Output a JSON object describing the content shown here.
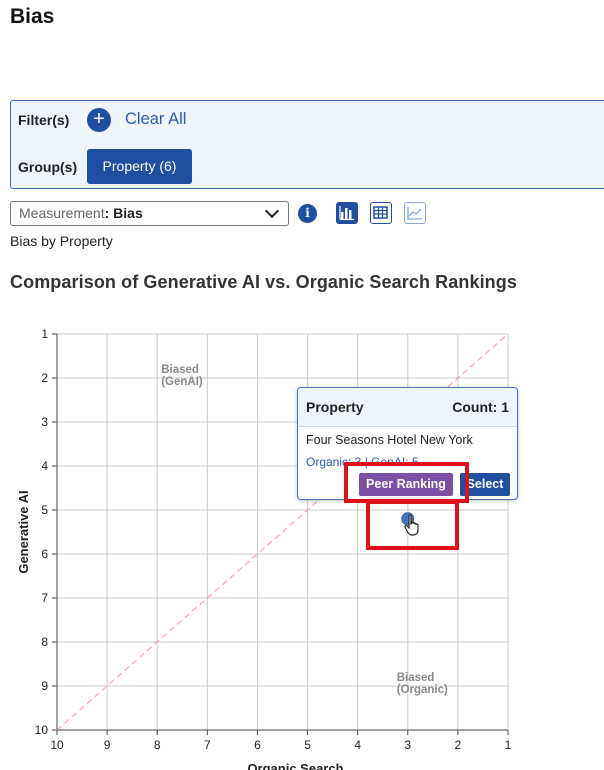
{
  "page": {
    "title": "Bias"
  },
  "filters": {
    "filter_label": "Filter(s)",
    "add_icon": "plus-circle-icon",
    "clear_all": "Clear All",
    "group_label": "Group(s)",
    "group_chip": "Property (6)"
  },
  "measurement": {
    "prefix": "Measurement",
    "separator": ": ",
    "value": "Bias",
    "dropdown_icon": "chevron-down-icon"
  },
  "toolbar": {
    "info_icon": "info-icon",
    "info_glyph": "i",
    "views": [
      {
        "icon": "bar-chart-icon",
        "active": true
      },
      {
        "icon": "table-icon",
        "active": false
      },
      {
        "icon": "line-chart-icon",
        "active": false
      }
    ]
  },
  "subtitle": "Bias by Property",
  "chart_title": "Comparison of Generative AI vs. Organic Search Rankings",
  "chart_data": {
    "type": "scatter",
    "xlabel": "Organic Search",
    "ylabel": "Generative AI",
    "xlim": [
      10,
      1
    ],
    "ylim": [
      1,
      10
    ],
    "x_reversed": true,
    "y_reversed": true,
    "x_ticks": [
      "10",
      "9",
      "8",
      "7",
      "6",
      "5",
      "4",
      "3",
      "2",
      "1"
    ],
    "y_ticks": [
      "1",
      "2",
      "3",
      "4",
      "5",
      "6",
      "7",
      "8",
      "9",
      "10"
    ],
    "grid": true,
    "diagonal_reference": true,
    "annotations": [
      {
        "line1": "Biased",
        "line2": "(GenAI)",
        "x": 8,
        "y": 2
      },
      {
        "line1": "Biased",
        "line2": "(Organic)",
        "x": 3.3,
        "y": 9
      }
    ],
    "points": [
      {
        "label": "Four Seasons Hotel New York",
        "x": 3,
        "y": 5.2
      }
    ],
    "colors": {
      "point": "#4a74c4",
      "diagonal": "#f4a7b1",
      "grid": "#cccccc",
      "annotation": "#888888"
    }
  },
  "tooltip": {
    "header_left": "Property",
    "header_right": "Count: 1",
    "property_name": "Four Seasons Hotel New York",
    "ranks": "Organic: 3 | GenAI: 5",
    "peer_button": "Peer Ranking",
    "select_button": "Select"
  },
  "colors": {
    "primary": "#1f4fa0",
    "panel_bg": "#eef5fd",
    "peer": "#7b4fa6",
    "highlight": "#e0101a"
  }
}
